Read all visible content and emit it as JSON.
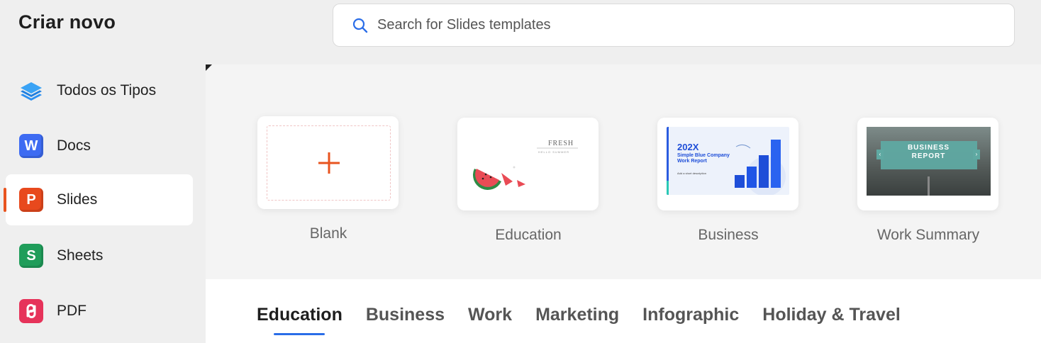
{
  "app_title": "Criar novo",
  "search": {
    "placeholder": "Search for Slides templates",
    "icon": "search-icon"
  },
  "sidebar": {
    "items": [
      {
        "label": "Todos os Tipos",
        "icon": "layers-icon",
        "active": false
      },
      {
        "label": "Docs",
        "icon": "docs-app-icon",
        "badge_letter": "W",
        "color": "#3d6bf2",
        "active": false
      },
      {
        "label": "Slides",
        "icon": "slides-app-icon",
        "badge_letter": "P",
        "color": "#e8491d",
        "active": true
      },
      {
        "label": "Sheets",
        "icon": "sheets-app-icon",
        "badge_letter": "S",
        "color": "#1f9d5a",
        "active": false
      },
      {
        "label": "PDF",
        "icon": "pdf-app-icon",
        "color": "#e6335a",
        "active": false
      }
    ]
  },
  "templates": [
    {
      "label": "Blank",
      "thumb": "plus-icon"
    },
    {
      "label": "Education",
      "thumb_title": "FRESH",
      "thumb_subtitle": "HELLO SUMMER"
    },
    {
      "label": "Business",
      "thumb_title": "202X",
      "thumb_subtitle": "Simple Blue Company Work Report",
      "thumb_caption": "Add a short description"
    },
    {
      "label": "Work Summary",
      "thumb_title": "BUSINESS",
      "thumb_subtitle": "REPORT"
    }
  ],
  "category_tabs": [
    "Education",
    "Business",
    "Work",
    "Marketing",
    "Infographic",
    "Holiday & Travel"
  ],
  "active_tab": "Education",
  "colors": {
    "accent_orange": "#e8541f",
    "tab_underline": "#2a6de8"
  }
}
